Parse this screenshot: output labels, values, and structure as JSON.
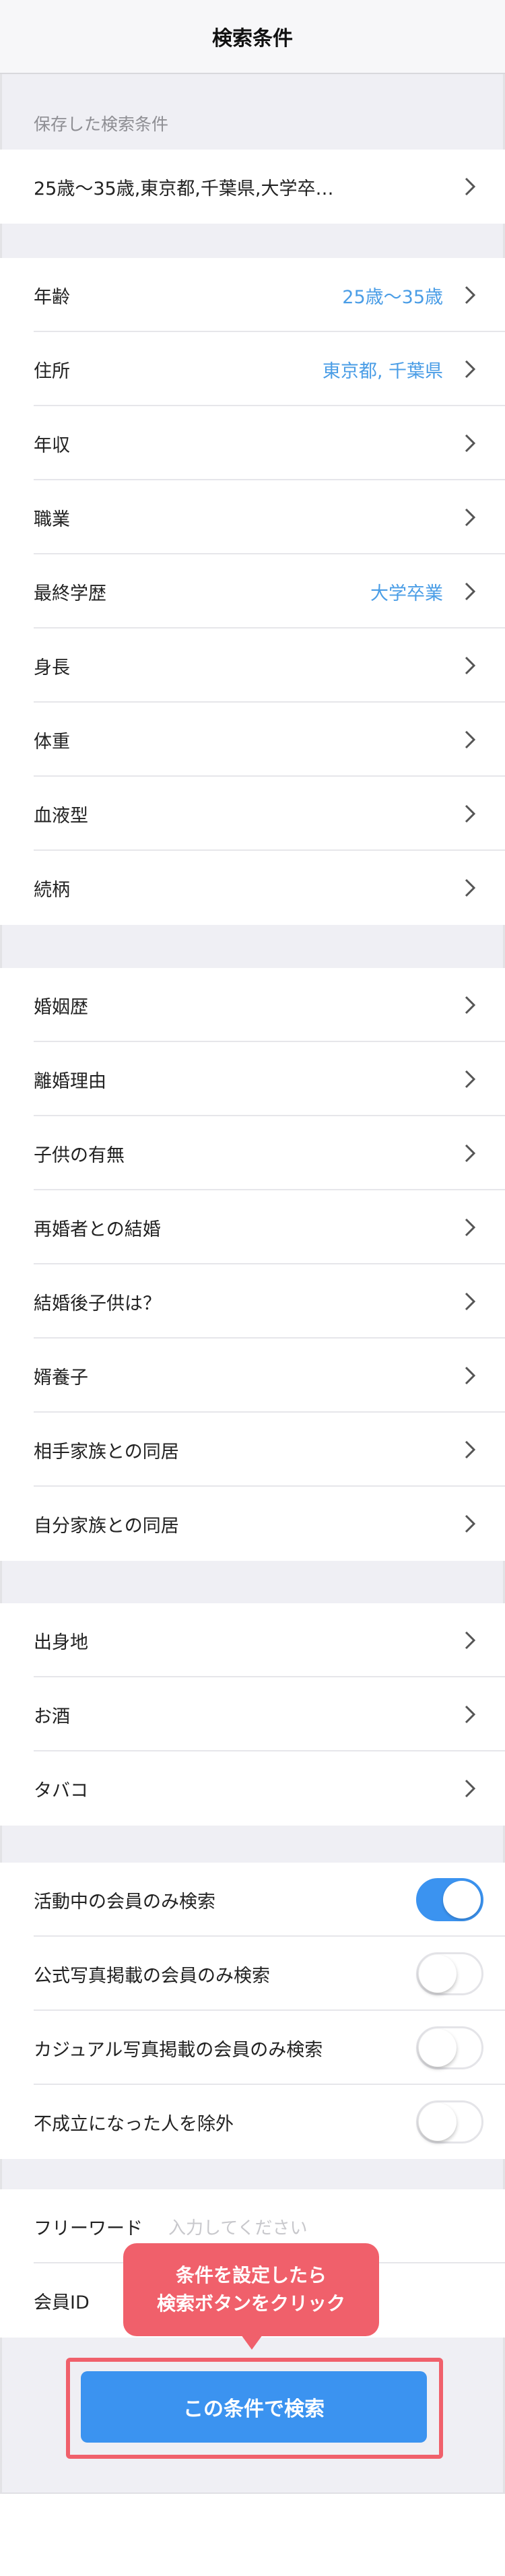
{
  "header": {
    "title": "検索条件"
  },
  "saved": {
    "label": "保存した検索条件",
    "summary": "25歳〜35歳,東京都,千葉県,大学卒…"
  },
  "basic": [
    {
      "label": "年齢",
      "value": "25歳〜35歳"
    },
    {
      "label": "住所",
      "value": "東京都, 千葉県"
    },
    {
      "label": "年収",
      "value": ""
    },
    {
      "label": "職業",
      "value": ""
    },
    {
      "label": "最終学歴",
      "value": "大学卒業"
    },
    {
      "label": "身長",
      "value": ""
    },
    {
      "label": "体重",
      "value": ""
    },
    {
      "label": "血液型",
      "value": ""
    },
    {
      "label": "続柄",
      "value": ""
    }
  ],
  "family": [
    {
      "label": "婚姻歴"
    },
    {
      "label": "離婚理由"
    },
    {
      "label": "子供の有無"
    },
    {
      "label": "再婚者との結婚"
    },
    {
      "label": "結婚後子供は？"
    },
    {
      "label": "婿養子"
    },
    {
      "label": "相手家族との同居"
    },
    {
      "label": "自分家族との同居"
    }
  ],
  "lifestyle": [
    {
      "label": "出身地"
    },
    {
      "label": "お酒"
    },
    {
      "label": "タバコ"
    }
  ],
  "toggles": [
    {
      "label": "活動中の会員のみ検索",
      "on": true
    },
    {
      "label": "公式写真掲載の会員のみ検索",
      "on": false
    },
    {
      "label": "カジュアル写真掲載の会員のみ検索",
      "on": false
    },
    {
      "label": "不成立になった人を除外",
      "on": false
    }
  ],
  "freeword": {
    "label": "フリーワード",
    "placeholder": "入力してください"
  },
  "member_id": {
    "label": "会員ID"
  },
  "tooltip": {
    "line1": "条件を設定したら",
    "line2": "検索ボタンをクリック"
  },
  "search_button": {
    "label": "この条件で検索"
  },
  "colors": {
    "accent": "#3b93f0",
    "value_text": "#4a9de6",
    "tooltip": "#f0606b",
    "background": "#efeff4"
  }
}
